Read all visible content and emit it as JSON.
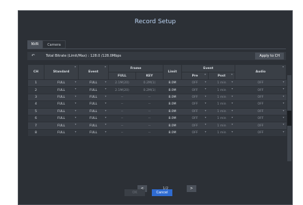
{
  "window": {
    "title": "Record Setup"
  },
  "tabs": [
    {
      "label": "NVR",
      "active": true
    },
    {
      "label": "Camera",
      "active": false
    }
  ],
  "bitrate": {
    "text": "Total Bitrate (Limit/Max) : 128.0 /128.0Mbps",
    "apply_label": "Apply to CH"
  },
  "table": {
    "headers": {
      "ch": "CH",
      "standard": "Standard",
      "event": "Event",
      "frame": "Frame",
      "frame_full": "FULL",
      "frame_key": "KEY",
      "limit": "Limit",
      "event_group": "Event",
      "pre": "Pre",
      "post": "Post",
      "audio": "Audio"
    },
    "rows": [
      {
        "ch": "1",
        "standard": "FULL",
        "event": "FULL",
        "full": "2.1M(20)",
        "key": "0.2M(1)",
        "limit": "8.0M",
        "pre": "OFF",
        "post": "1 min",
        "audio": "OFF"
      },
      {
        "ch": "2",
        "standard": "FULL",
        "event": "FULL",
        "full": "2.1M(20)",
        "key": "0.2M(1)",
        "limit": "8.0M",
        "pre": "OFF",
        "post": "1 min",
        "audio": "OFF"
      },
      {
        "ch": "3",
        "standard": "FULL",
        "event": "FULL",
        "full": "--",
        "key": "--",
        "limit": "8.0M",
        "pre": "OFF",
        "post": "1 min",
        "audio": "OFF"
      },
      {
        "ch": "4",
        "standard": "FULL",
        "event": "FULL",
        "full": "--",
        "key": "--",
        "limit": "8.0M",
        "pre": "OFF",
        "post": "1 min",
        "audio": "OFF"
      },
      {
        "ch": "5",
        "standard": "FULL",
        "event": "FULL",
        "full": "--",
        "key": "--",
        "limit": "8.0M",
        "pre": "OFF",
        "post": "1 min",
        "audio": "OFF"
      },
      {
        "ch": "6",
        "standard": "FULL",
        "event": "FULL",
        "full": "--",
        "key": "--",
        "limit": "8.0M",
        "pre": "OFF",
        "post": "1 min",
        "audio": "OFF"
      },
      {
        "ch": "7",
        "standard": "FULL",
        "event": "FULL",
        "full": "--",
        "key": "--",
        "limit": "8.0M",
        "pre": "OFF",
        "post": "1 min",
        "audio": "OFF"
      },
      {
        "ch": "8",
        "standard": "FULL",
        "event": "FULL",
        "full": "--",
        "key": "--",
        "limit": "8.0M",
        "pre": "OFF",
        "post": "1 min",
        "audio": "OFF"
      }
    ]
  },
  "pager": {
    "text": "1/2",
    "prev": "<",
    "next": ">"
  },
  "footer": {
    "ok": "OK",
    "cancel": "Cancel"
  },
  "icons": {
    "back": "back-arrow-icon",
    "caret": "caret-down-icon"
  },
  "colors": {
    "dialog_bg": "#2c3036",
    "accent": "#2f6bd0",
    "title": "#bcd4f3"
  }
}
